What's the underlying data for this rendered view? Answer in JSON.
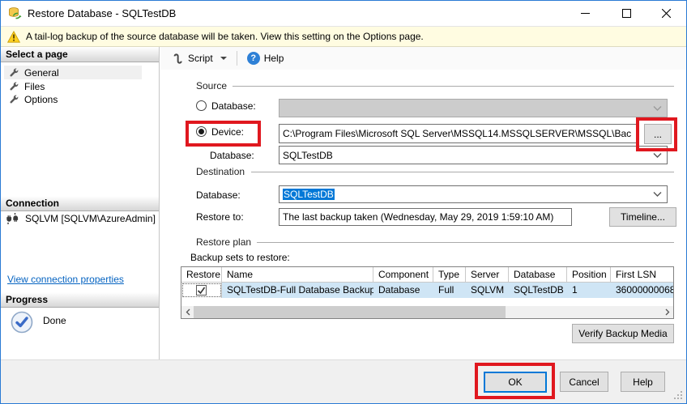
{
  "window": {
    "title": "Restore Database - SQLTestDB"
  },
  "warning": {
    "text": "A tail-log backup of the source database will be taken. View this setting on the Options page."
  },
  "sidebar": {
    "select_a_page": {
      "header": "Select a page",
      "items": [
        {
          "label": "General"
        },
        {
          "label": "Files"
        },
        {
          "label": "Options"
        }
      ]
    },
    "connection": {
      "header": "Connection",
      "server": "SQLVM [SQLVM\\AzureAdmin]",
      "link": "View connection properties"
    },
    "progress": {
      "header": "Progress",
      "status": "Done"
    }
  },
  "toolbar": {
    "script_label": "Script",
    "help_label": "Help",
    "help_glyph": "?"
  },
  "source": {
    "caption": "Source",
    "database_radio_label": "Database:",
    "device_radio_label": "Device:",
    "device_selected": true,
    "device_path": "C:\\Program Files\\Microsoft SQL Server\\MSSQL14.MSSQLSERVER\\MSSQL\\Bac",
    "browse_label": "...",
    "database_label": "Database:",
    "database_value": "SQLTestDB"
  },
  "destination": {
    "caption": "Destination",
    "database_label": "Database:",
    "database_value": "SQLTestDB",
    "restore_to_label": "Restore to:",
    "restore_to_value": "The last backup taken (Wednesday, May 29, 2019 1:59:10 AM)",
    "timeline_label": "Timeline..."
  },
  "restore_plan": {
    "caption": "Restore plan",
    "backup_sets_label": "Backup sets to restore:",
    "table": {
      "columns": [
        "Restore",
        "Name",
        "Component",
        "Type",
        "Server",
        "Database",
        "Position",
        "First LSN"
      ],
      "rows": [
        {
          "restore_checked": true,
          "name": "SQLTestDB-Full Database Backup",
          "component": "Database",
          "type": "Full",
          "server": "SQLVM",
          "database": "SQLTestDB",
          "position": "1",
          "first_lsn": "36000000068"
        }
      ]
    },
    "verify_button_label": "Verify Backup Media"
  },
  "footer": {
    "ok_label": "OK",
    "cancel_label": "Cancel",
    "help_label": "Help"
  },
  "colors": {
    "accent_blue": "#0078d7",
    "annotation_red": "#e0181f",
    "warning_bg": "#fffce1",
    "selected_row_blue": "#cfe5f5",
    "window_border_blue": "#2a7ad4"
  }
}
